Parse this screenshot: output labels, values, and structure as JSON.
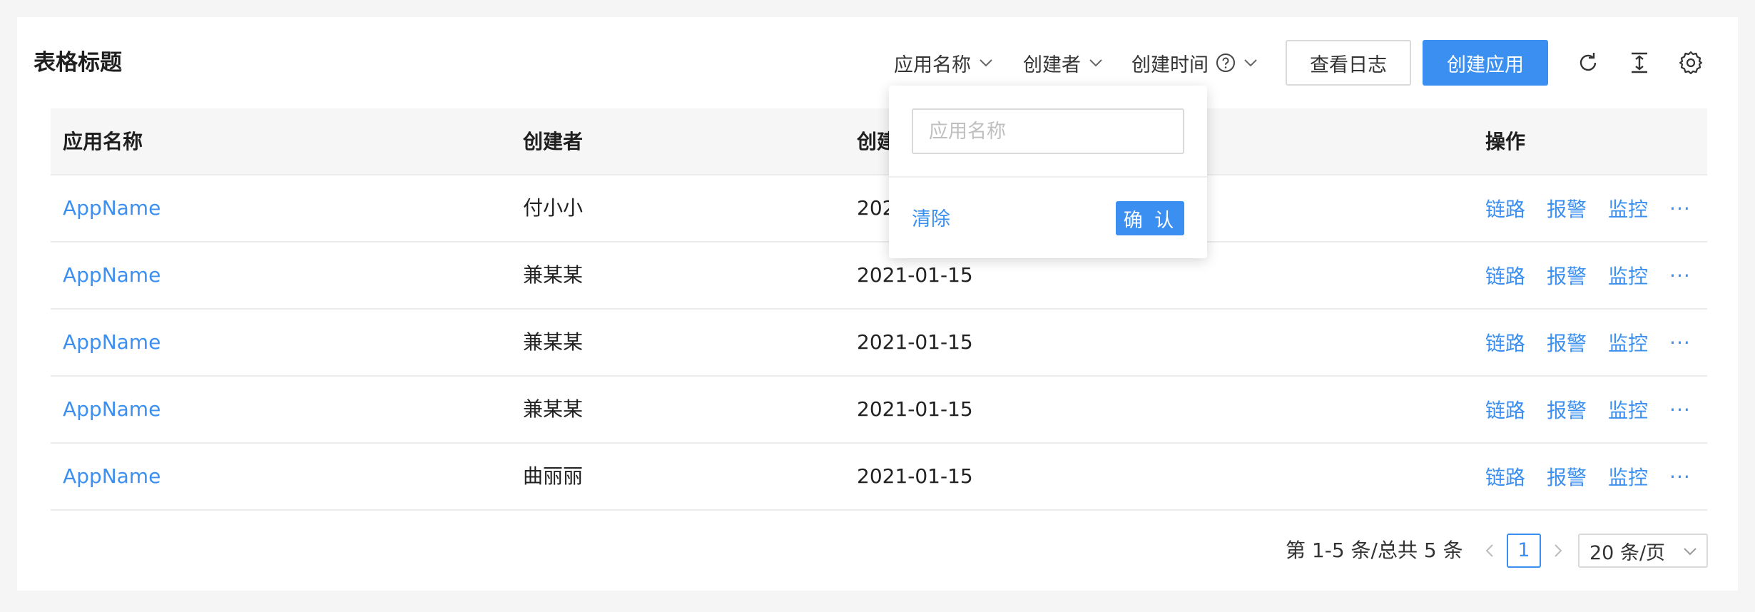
{
  "header": {
    "title": "表格标题",
    "filters": [
      {
        "label": "应用名称"
      },
      {
        "label": "创建者"
      },
      {
        "label": "创建时间"
      }
    ],
    "view_log_label": "查看日志",
    "create_app_label": "创建应用",
    "icons": [
      "refresh-icon",
      "density-icon",
      "settings-icon"
    ]
  },
  "table": {
    "columns": [
      "应用名称",
      "创建者",
      "创建时间",
      "操作"
    ],
    "rows": [
      {
        "app": "AppName",
        "creator": "付小小",
        "date": "2021-01-15"
      },
      {
        "app": "AppName",
        "creator": "兼某某",
        "date": "2021-01-15"
      },
      {
        "app": "AppName",
        "creator": "兼某某",
        "date": "2021-01-15"
      },
      {
        "app": "AppName",
        "creator": "兼某某",
        "date": "2021-01-15"
      },
      {
        "app": "AppName",
        "creator": "曲丽丽",
        "date": "2021-01-15"
      }
    ],
    "actions": [
      "链路",
      "报警",
      "监控",
      "···"
    ]
  },
  "pagination": {
    "total_text": "第 1-5 条/总共 5 条",
    "current_page": "1",
    "page_size": "20 条/页"
  },
  "popover": {
    "placeholder": "应用名称",
    "clear_label": "清除",
    "confirm_label": "确 认"
  },
  "colors": {
    "primary": "#3b8ff0",
    "background": "#f5f5f5",
    "header_bg": "#f6f6f6",
    "border": "#ececec"
  }
}
